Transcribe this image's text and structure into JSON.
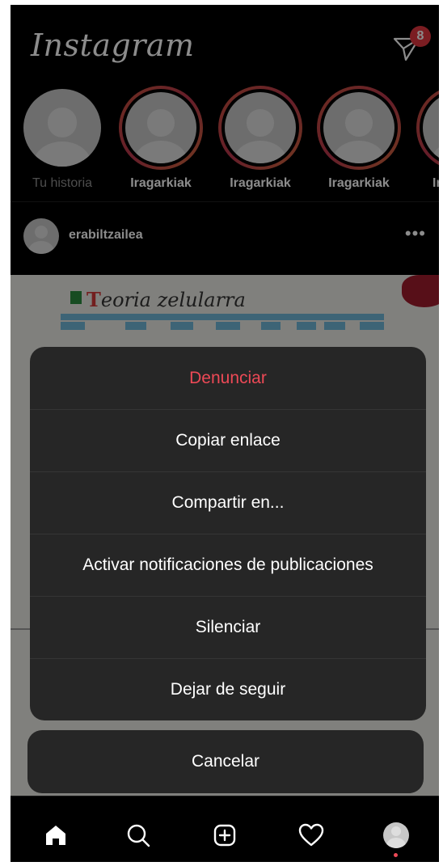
{
  "app": {
    "logo": "Instagram"
  },
  "header": {
    "dm_badge_count": "8"
  },
  "stories": [
    {
      "name": "Tu historia",
      "own": true
    },
    {
      "name": "Iragarkiak",
      "own": false
    },
    {
      "name": "Iragarkiak",
      "own": false
    },
    {
      "name": "Iragarkiak",
      "own": false
    },
    {
      "name": "Ir",
      "own": false
    }
  ],
  "post": {
    "username": "erabiltzailea",
    "more": "•••",
    "image_title": "eoria zelularra",
    "image_title_initial": "T"
  },
  "action_sheet": {
    "items": [
      {
        "label": "Denunciar",
        "style": "danger"
      },
      {
        "label": "Copiar enlace",
        "style": "default"
      },
      {
        "label": "Compartir en...",
        "style": "default"
      },
      {
        "label": "Activar notificaciones de publicaciones",
        "style": "default"
      },
      {
        "label": "Silenciar",
        "style": "default"
      },
      {
        "label": "Dejar de seguir",
        "style": "default"
      }
    ],
    "cancel": "Cancelar"
  },
  "nav": {
    "icons": [
      "home-icon",
      "search-icon",
      "new-post-icon",
      "activity-icon",
      "profile-icon"
    ]
  },
  "colors": {
    "danger": "#ed4956",
    "sheet_bg": "#262626",
    "badge": "#e0363e"
  }
}
